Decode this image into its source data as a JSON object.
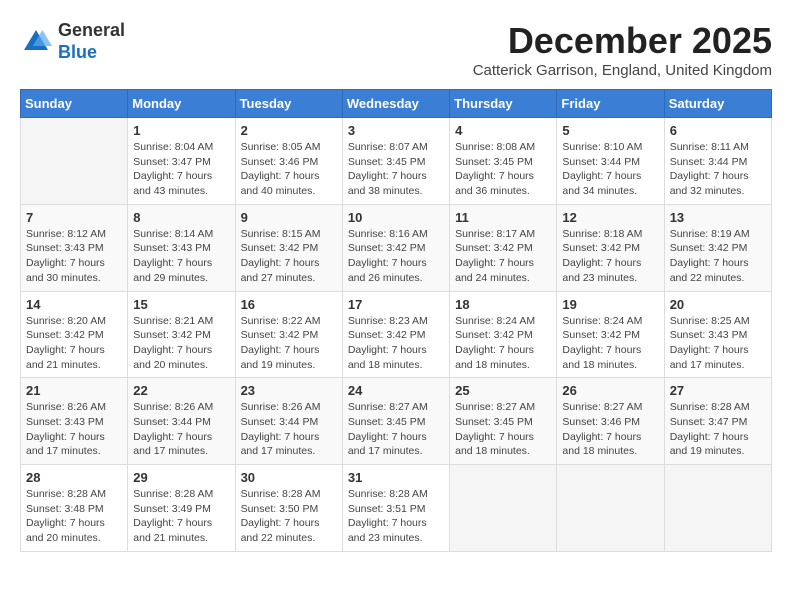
{
  "header": {
    "logo": {
      "general": "General",
      "blue": "Blue"
    },
    "title": "December 2025",
    "subtitle": "Catterick Garrison, England, United Kingdom"
  },
  "calendar": {
    "weekdays": [
      "Sunday",
      "Monday",
      "Tuesday",
      "Wednesday",
      "Thursday",
      "Friday",
      "Saturday"
    ],
    "weeks": [
      [
        {
          "day": null,
          "sunrise": null,
          "sunset": null,
          "daylight": null
        },
        {
          "day": "1",
          "sunrise": "Sunrise: 8:04 AM",
          "sunset": "Sunset: 3:47 PM",
          "daylight": "Daylight: 7 hours and 43 minutes."
        },
        {
          "day": "2",
          "sunrise": "Sunrise: 8:05 AM",
          "sunset": "Sunset: 3:46 PM",
          "daylight": "Daylight: 7 hours and 40 minutes."
        },
        {
          "day": "3",
          "sunrise": "Sunrise: 8:07 AM",
          "sunset": "Sunset: 3:45 PM",
          "daylight": "Daylight: 7 hours and 38 minutes."
        },
        {
          "day": "4",
          "sunrise": "Sunrise: 8:08 AM",
          "sunset": "Sunset: 3:45 PM",
          "daylight": "Daylight: 7 hours and 36 minutes."
        },
        {
          "day": "5",
          "sunrise": "Sunrise: 8:10 AM",
          "sunset": "Sunset: 3:44 PM",
          "daylight": "Daylight: 7 hours and 34 minutes."
        },
        {
          "day": "6",
          "sunrise": "Sunrise: 8:11 AM",
          "sunset": "Sunset: 3:44 PM",
          "daylight": "Daylight: 7 hours and 32 minutes."
        }
      ],
      [
        {
          "day": "7",
          "sunrise": "Sunrise: 8:12 AM",
          "sunset": "Sunset: 3:43 PM",
          "daylight": "Daylight: 7 hours and 30 minutes."
        },
        {
          "day": "8",
          "sunrise": "Sunrise: 8:14 AM",
          "sunset": "Sunset: 3:43 PM",
          "daylight": "Daylight: 7 hours and 29 minutes."
        },
        {
          "day": "9",
          "sunrise": "Sunrise: 8:15 AM",
          "sunset": "Sunset: 3:42 PM",
          "daylight": "Daylight: 7 hours and 27 minutes."
        },
        {
          "day": "10",
          "sunrise": "Sunrise: 8:16 AM",
          "sunset": "Sunset: 3:42 PM",
          "daylight": "Daylight: 7 hours and 26 minutes."
        },
        {
          "day": "11",
          "sunrise": "Sunrise: 8:17 AM",
          "sunset": "Sunset: 3:42 PM",
          "daylight": "Daylight: 7 hours and 24 minutes."
        },
        {
          "day": "12",
          "sunrise": "Sunrise: 8:18 AM",
          "sunset": "Sunset: 3:42 PM",
          "daylight": "Daylight: 7 hours and 23 minutes."
        },
        {
          "day": "13",
          "sunrise": "Sunrise: 8:19 AM",
          "sunset": "Sunset: 3:42 PM",
          "daylight": "Daylight: 7 hours and 22 minutes."
        }
      ],
      [
        {
          "day": "14",
          "sunrise": "Sunrise: 8:20 AM",
          "sunset": "Sunset: 3:42 PM",
          "daylight": "Daylight: 7 hours and 21 minutes."
        },
        {
          "day": "15",
          "sunrise": "Sunrise: 8:21 AM",
          "sunset": "Sunset: 3:42 PM",
          "daylight": "Daylight: 7 hours and 20 minutes."
        },
        {
          "day": "16",
          "sunrise": "Sunrise: 8:22 AM",
          "sunset": "Sunset: 3:42 PM",
          "daylight": "Daylight: 7 hours and 19 minutes."
        },
        {
          "day": "17",
          "sunrise": "Sunrise: 8:23 AM",
          "sunset": "Sunset: 3:42 PM",
          "daylight": "Daylight: 7 hours and 18 minutes."
        },
        {
          "day": "18",
          "sunrise": "Sunrise: 8:24 AM",
          "sunset": "Sunset: 3:42 PM",
          "daylight": "Daylight: 7 hours and 18 minutes."
        },
        {
          "day": "19",
          "sunrise": "Sunrise: 8:24 AM",
          "sunset": "Sunset: 3:42 PM",
          "daylight": "Daylight: 7 hours and 18 minutes."
        },
        {
          "day": "20",
          "sunrise": "Sunrise: 8:25 AM",
          "sunset": "Sunset: 3:43 PM",
          "daylight": "Daylight: 7 hours and 17 minutes."
        }
      ],
      [
        {
          "day": "21",
          "sunrise": "Sunrise: 8:26 AM",
          "sunset": "Sunset: 3:43 PM",
          "daylight": "Daylight: 7 hours and 17 minutes."
        },
        {
          "day": "22",
          "sunrise": "Sunrise: 8:26 AM",
          "sunset": "Sunset: 3:44 PM",
          "daylight": "Daylight: 7 hours and 17 minutes."
        },
        {
          "day": "23",
          "sunrise": "Sunrise: 8:26 AM",
          "sunset": "Sunset: 3:44 PM",
          "daylight": "Daylight: 7 hours and 17 minutes."
        },
        {
          "day": "24",
          "sunrise": "Sunrise: 8:27 AM",
          "sunset": "Sunset: 3:45 PM",
          "daylight": "Daylight: 7 hours and 17 minutes."
        },
        {
          "day": "25",
          "sunrise": "Sunrise: 8:27 AM",
          "sunset": "Sunset: 3:45 PM",
          "daylight": "Daylight: 7 hours and 18 minutes."
        },
        {
          "day": "26",
          "sunrise": "Sunrise: 8:27 AM",
          "sunset": "Sunset: 3:46 PM",
          "daylight": "Daylight: 7 hours and 18 minutes."
        },
        {
          "day": "27",
          "sunrise": "Sunrise: 8:28 AM",
          "sunset": "Sunset: 3:47 PM",
          "daylight": "Daylight: 7 hours and 19 minutes."
        }
      ],
      [
        {
          "day": "28",
          "sunrise": "Sunrise: 8:28 AM",
          "sunset": "Sunset: 3:48 PM",
          "daylight": "Daylight: 7 hours and 20 minutes."
        },
        {
          "day": "29",
          "sunrise": "Sunrise: 8:28 AM",
          "sunset": "Sunset: 3:49 PM",
          "daylight": "Daylight: 7 hours and 21 minutes."
        },
        {
          "day": "30",
          "sunrise": "Sunrise: 8:28 AM",
          "sunset": "Sunset: 3:50 PM",
          "daylight": "Daylight: 7 hours and 22 minutes."
        },
        {
          "day": "31",
          "sunrise": "Sunrise: 8:28 AM",
          "sunset": "Sunset: 3:51 PM",
          "daylight": "Daylight: 7 hours and 23 minutes."
        },
        {
          "day": null,
          "sunrise": null,
          "sunset": null,
          "daylight": null
        },
        {
          "day": null,
          "sunrise": null,
          "sunset": null,
          "daylight": null
        },
        {
          "day": null,
          "sunrise": null,
          "sunset": null,
          "daylight": null
        }
      ]
    ]
  }
}
